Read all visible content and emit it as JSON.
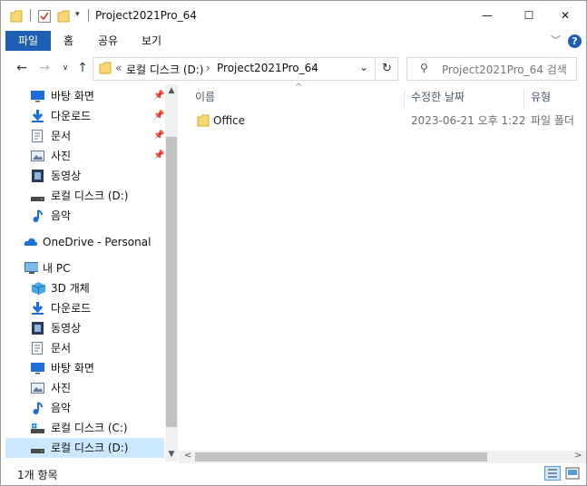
{
  "window": {
    "title": "Project2021Pro_64",
    "controls": {
      "minimize": "—",
      "maximize": "☐",
      "close": "✕"
    }
  },
  "ribbon": {
    "file_tab": "파일",
    "tabs": [
      "홈",
      "공유",
      "보기"
    ]
  },
  "address": {
    "overflow": "«",
    "crumbs": [
      "로컬 디스크 (D:)",
      "Project2021Pro_64"
    ],
    "separator": "›"
  },
  "search": {
    "placeholder": "Project2021Pro_64 검색"
  },
  "nav": {
    "quick_access": [
      {
        "label": "바탕 화면",
        "icon": "desktop-icon",
        "pinned": true
      },
      {
        "label": "다운로드",
        "icon": "download-icon",
        "pinned": true
      },
      {
        "label": "문서",
        "icon": "document-icon",
        "pinned": true
      },
      {
        "label": "사진",
        "icon": "pictures-icon",
        "pinned": true
      },
      {
        "label": "동영상",
        "icon": "video-icon",
        "pinned": false
      },
      {
        "label": "로컬 디스크 (D:)",
        "icon": "drive-icon",
        "pinned": false
      },
      {
        "label": "음악",
        "icon": "music-icon",
        "pinned": false
      }
    ],
    "onedrive": "OneDrive - Personal",
    "this_pc": "내 PC",
    "pc_items": [
      {
        "label": "3D 개체",
        "icon": "3d-objects-icon"
      },
      {
        "label": "다운로드",
        "icon": "download-icon"
      },
      {
        "label": "동영상",
        "icon": "video-icon"
      },
      {
        "label": "문서",
        "icon": "document-icon"
      },
      {
        "label": "바탕 화면",
        "icon": "desktop-icon"
      },
      {
        "label": "사진",
        "icon": "pictures-icon"
      },
      {
        "label": "음악",
        "icon": "music-icon"
      },
      {
        "label": "로컬 디스크 (C:)",
        "icon": "drive-icon"
      },
      {
        "label": "로컬 디스크 (D:)",
        "icon": "drive-icon",
        "selected": true
      }
    ]
  },
  "columns": [
    "이름",
    "수정한 날짜",
    "유형"
  ],
  "files": [
    {
      "name": "Office",
      "modified": "2023-06-21 오후 1:22",
      "type": "파일 폴더"
    }
  ],
  "status": {
    "count": "1개 항목"
  },
  "colors": {
    "accent": "#1f5fb3",
    "selection": "#cce8ff",
    "folder": "#f8d775"
  }
}
